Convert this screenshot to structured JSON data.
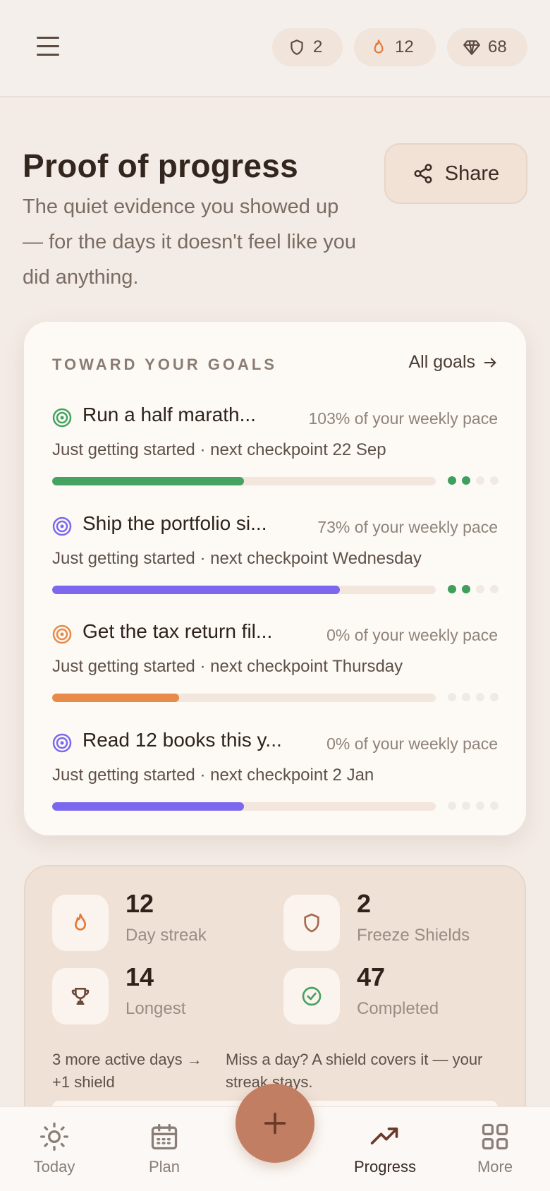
{
  "header": {
    "shields": "2",
    "streak": "12",
    "gems": "68"
  },
  "page": {
    "title": "Proof of progress",
    "subtitle": "The quiet evidence you showed up — for the days it doesn't feel like you did anything.",
    "share_label": "Share"
  },
  "goals": {
    "heading": "TOWARD YOUR GOALS",
    "all_goals_label": "All goals",
    "items": [
      {
        "name": "Run a half marath...",
        "pace": "103% of your weekly pace",
        "meta": "Just getting started · next checkpoint 22 Sep",
        "color": "#46a260",
        "progress": 0.5,
        "dots_on": 2
      },
      {
        "name": "Ship the portfolio si...",
        "pace": "73% of your weekly pace",
        "meta": "Just getting started · next checkpoint Wednesday",
        "color": "#7b68ee",
        "progress": 0.75,
        "dots_on": 2
      },
      {
        "name": "Get the tax return fil...",
        "pace": "0% of your weekly pace",
        "meta": "Just getting started · next checkpoint Thursday",
        "color": "#e88a4a",
        "progress": 0.33,
        "dots_on": 0
      },
      {
        "name": "Read 12 books this y...",
        "pace": "0% of your weekly pace",
        "meta": "Just getting started · next checkpoint 2 Jan",
        "color": "#7b68ee",
        "progress": 0.5,
        "dots_on": 0
      }
    ]
  },
  "stats": {
    "day_streak": {
      "value": "12",
      "label": "Day streak"
    },
    "freeze_shields": {
      "value": "2",
      "label": "Freeze Shields"
    },
    "longest": {
      "value": "14",
      "label": "Longest"
    },
    "completed": {
      "value": "47",
      "label": "Completed"
    },
    "note_left": "3 more active days → +1 shield",
    "note_right": "Miss a day? A shield covers it — your streak stays."
  },
  "nav": {
    "today": "Today",
    "plan": "Plan",
    "progress": "Progress",
    "more": "More"
  },
  "colors": {
    "accent": "#c27e63",
    "green": "#46a260",
    "purple": "#7b68ee",
    "orange": "#e88a4a"
  }
}
